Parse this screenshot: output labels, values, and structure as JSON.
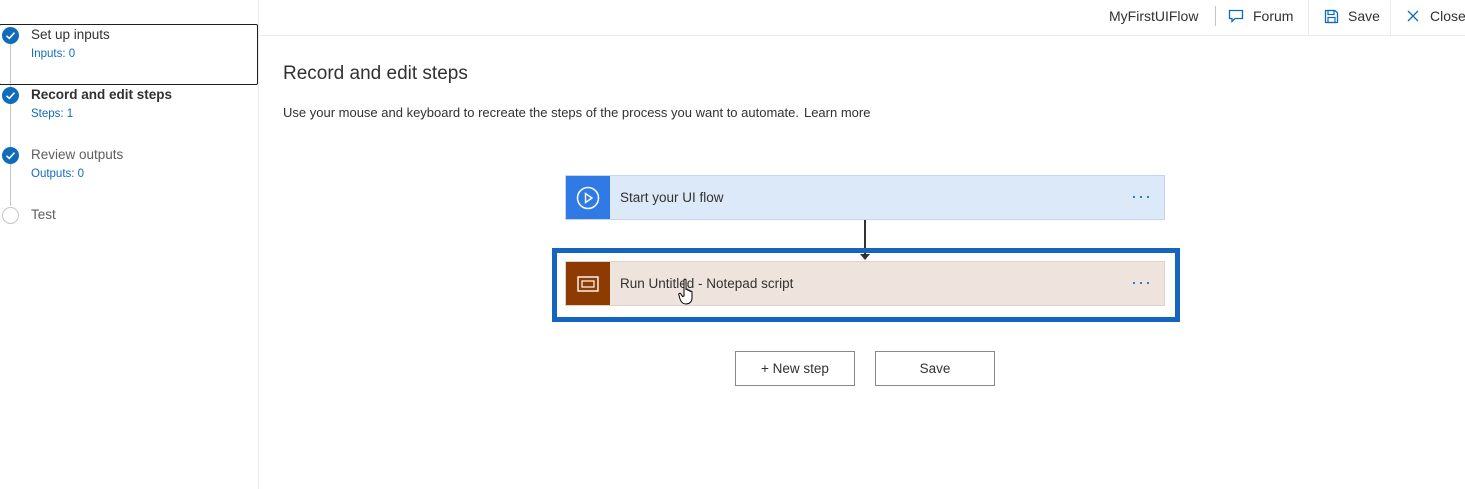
{
  "topbar": {
    "flow_name": "MyFirstUIFlow",
    "forum_label": "Forum",
    "save_label": "Save",
    "close_label": "Close"
  },
  "steps": [
    {
      "title": "Set up inputs",
      "subtitle": "Inputs: 0",
      "state": "complete"
    },
    {
      "title": "Record and edit steps",
      "subtitle": "Steps: 1",
      "state": "complete"
    },
    {
      "title": "Review outputs",
      "subtitle": "Outputs: 0",
      "state": "complete"
    },
    {
      "title": "Test",
      "subtitle": "",
      "state": "pending"
    }
  ],
  "main": {
    "heading": "Record and edit steps",
    "description": "Use your mouse and keyboard to recreate the steps of the process you want to automate.",
    "learn_more": "Learn more",
    "cards": [
      {
        "label": "Start your UI flow",
        "more": "···",
        "icon": "play-circle-icon",
        "color": "#2f7ae5"
      },
      {
        "label": "Run Untitled - Notepad script",
        "more": "···",
        "icon": "window-icon",
        "color": "#8e3b02"
      }
    ],
    "new_step_label": "+ New step",
    "save_label": "Save"
  },
  "colors": {
    "accent": "#0f6cbd",
    "highlight": "#1565c0"
  }
}
